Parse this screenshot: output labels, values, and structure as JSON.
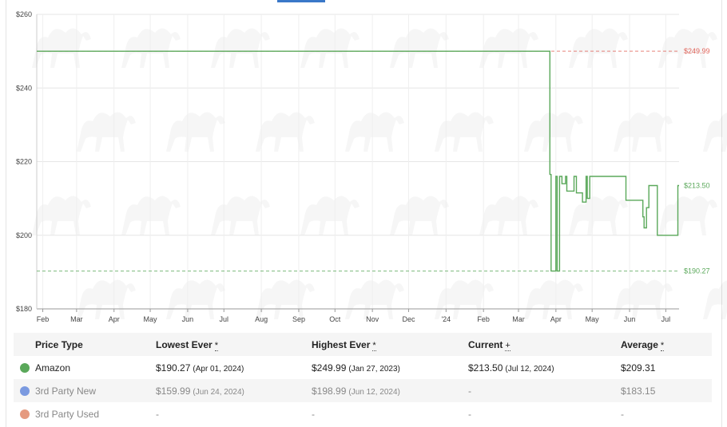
{
  "chart_data": {
    "type": "line",
    "step": true,
    "y_range": [
      180,
      260
    ],
    "y_ticks": [
      {
        "value": 260,
        "label": "$260"
      },
      {
        "value": 240,
        "label": "$240"
      },
      {
        "value": 220,
        "label": "$220"
      },
      {
        "value": 200,
        "label": "$200"
      },
      {
        "value": 180,
        "label": "$180"
      }
    ],
    "x_range": [
      "2023-01-27",
      "2024-07-12"
    ],
    "x_ticks": [
      {
        "date": "2023-02-01",
        "label": "Feb"
      },
      {
        "date": "2023-03-01",
        "label": "Mar"
      },
      {
        "date": "2023-04-01",
        "label": "Apr"
      },
      {
        "date": "2023-05-01",
        "label": "May"
      },
      {
        "date": "2023-06-01",
        "label": "Jun"
      },
      {
        "date": "2023-07-01",
        "label": "Jul"
      },
      {
        "date": "2023-08-01",
        "label": "Aug"
      },
      {
        "date": "2023-09-01",
        "label": "Sep"
      },
      {
        "date": "2023-10-01",
        "label": "Oct"
      },
      {
        "date": "2023-11-01",
        "label": "Nov"
      },
      {
        "date": "2023-12-01",
        "label": "Dec"
      },
      {
        "date": "2024-01-01",
        "label": "'24"
      },
      {
        "date": "2024-02-01",
        "label": "Feb"
      },
      {
        "date": "2024-03-01",
        "label": "Mar"
      },
      {
        "date": "2024-04-01",
        "label": "Apr"
      },
      {
        "date": "2024-05-01",
        "label": "May"
      },
      {
        "date": "2024-06-01",
        "label": "Jun"
      },
      {
        "date": "2024-07-01",
        "label": "Jul"
      }
    ],
    "grid": true,
    "series": [
      {
        "name": "Amazon",
        "color": "#5aa85a",
        "points": [
          [
            "2023-01-27",
            249.99
          ],
          [
            "2024-03-27",
            216.5
          ],
          [
            "2024-03-28",
            190.27
          ],
          [
            "2024-04-01",
            216.0
          ],
          [
            "2024-04-02",
            190.27
          ],
          [
            "2024-04-04",
            216.0
          ],
          [
            "2024-04-06",
            214.0
          ],
          [
            "2024-04-09",
            216.0
          ],
          [
            "2024-04-10",
            212.0
          ],
          [
            "2024-04-16",
            216.0
          ],
          [
            "2024-04-18",
            211.5
          ],
          [
            "2024-04-23",
            209.0
          ],
          [
            "2024-04-26",
            216.0
          ],
          [
            "2024-04-27",
            210.0
          ],
          [
            "2024-04-29",
            216.0
          ],
          [
            "2024-05-29",
            209.5
          ],
          [
            "2024-06-12",
            205.0
          ],
          [
            "2024-06-13",
            202.0
          ],
          [
            "2024-06-15",
            207.5
          ],
          [
            "2024-06-17",
            213.5
          ],
          [
            "2024-06-24",
            200.0
          ],
          [
            "2024-07-11",
            213.5
          ],
          [
            "2024-07-12",
            213.5
          ]
        ]
      }
    ],
    "reference_lines": [
      {
        "value": 249.99,
        "label": "$249.99",
        "color": "#e0645a"
      },
      {
        "value": 190.27,
        "label": "$190.27",
        "color": "#5aa85a"
      }
    ],
    "end_label": {
      "value": 213.5,
      "label": "$213.50",
      "color": "#5aa85a"
    }
  },
  "table": {
    "headers": {
      "type": "Price Type",
      "lowest": "Lowest Ever",
      "highest": "Highest Ever",
      "current": "Current",
      "average": "Average"
    },
    "header_marks": {
      "lowest": "*",
      "highest": "*",
      "current": "+",
      "average": "*"
    },
    "rows": [
      {
        "name": "Amazon",
        "color": "#5aa85a",
        "lowest": "$190.27",
        "lowest_date": "(Apr 01, 2024)",
        "highest": "$249.99",
        "highest_date": "(Jan 27, 2023)",
        "current": "$213.50",
        "current_date": "(Jul 12, 2024)",
        "average": "$209.31"
      },
      {
        "name": "3rd Party New",
        "color": "#7b9ae0",
        "lowest": "$159.99",
        "lowest_date": "(Jun 24, 2024)",
        "highest": "$198.99",
        "highest_date": "(Jun 12, 2024)",
        "current": "-",
        "current_date": "",
        "average": "$183.15"
      },
      {
        "name": "3rd Party Used",
        "color": "#e59a80",
        "lowest": "-",
        "lowest_date": "",
        "highest": "-",
        "highest_date": "",
        "current": "-",
        "current_date": "",
        "average": "-"
      }
    ]
  }
}
